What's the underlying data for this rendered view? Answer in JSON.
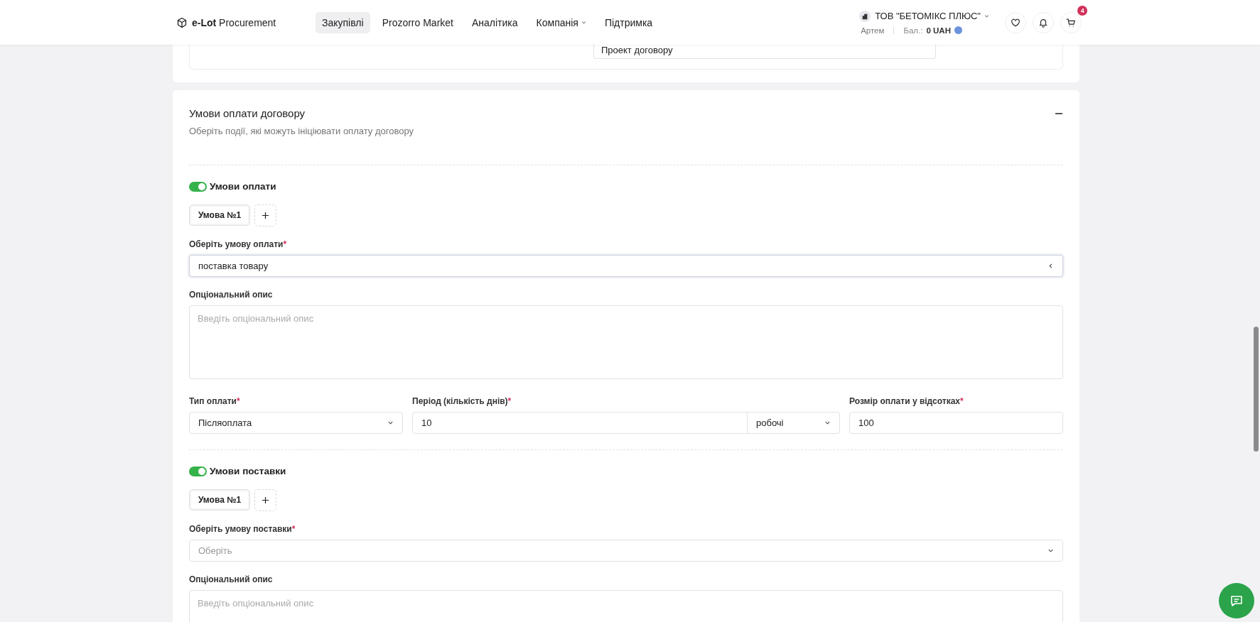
{
  "header": {
    "logo": "**e-Lot** Procurement",
    "nav": [
      {
        "label": "Закупівлі",
        "selected": true,
        "dropdown": false
      },
      {
        "label": "Prozorro Market",
        "selected": false,
        "dropdown": false
      },
      {
        "label": "Аналітика",
        "selected": false,
        "dropdown": false
      },
      {
        "label": "Компанія",
        "selected": false,
        "dropdown": true
      },
      {
        "label": "Підтримка",
        "selected": false,
        "dropdown": false
      }
    ],
    "company": "ТОВ \"БЕТОМІКС ПЛЮС\"",
    "user": "Артем",
    "balance_label": "Бал.:",
    "balance": "0 UAH",
    "cart_count": "4"
  },
  "top_card": {
    "field_value": "Проект договору"
  },
  "section": {
    "title": "Умови оплати договору",
    "subtitle": "Оберіть події, які можуть ініціювати оплату договору",
    "expanded": true,
    "blocks": [
      {
        "toggle_label": "Умови оплати",
        "on": true,
        "tabs": [
          {
            "label": "Умова №1",
            "selected": true
          }
        ],
        "select_label": "Оберіть умову оплати",
        "required_mark": "*",
        "select_value": "поставка товару",
        "select_focused": true,
        "desc_label": "Опціональний опис",
        "desc_placeholder": "Введіть опціональний опис",
        "payment": {
          "type_label": "Тип оплати",
          "type_mark": "*",
          "type_value": "Післяоплата",
          "period_label": "Період (кількість днів)",
          "period_mark": "*",
          "period_value": "10",
          "period_unit": "робочі",
          "percent_label": "Розмір оплати у відсотках",
          "percent_mark": "*",
          "percent_value": "100"
        }
      },
      {
        "toggle_label": "Умови поставки",
        "on": true,
        "tabs": [
          {
            "label": "Умова №1",
            "selected": true
          }
        ],
        "select_label": "Оберіть умову поставки",
        "required_mark": "*",
        "select_placeholder": "Оберіть",
        "select_focused": false,
        "desc_label": "Опціональний опис",
        "desc_placeholder": "Введіть опціональний опис"
      }
    ]
  }
}
